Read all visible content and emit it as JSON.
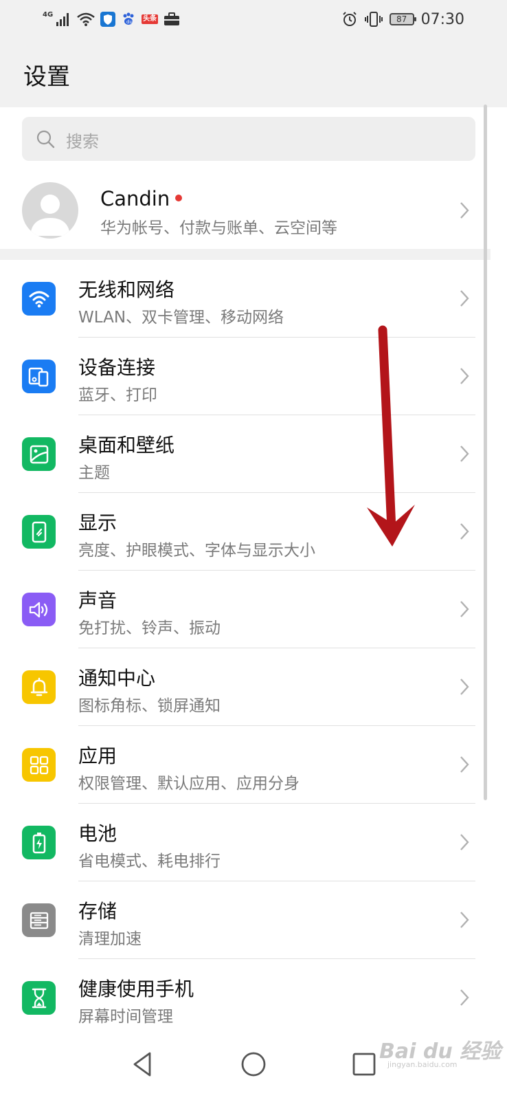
{
  "status_bar": {
    "network": "4G",
    "news_badge": "头条",
    "battery": "87",
    "time": "07:30"
  },
  "header": {
    "title": "设置"
  },
  "search": {
    "placeholder": "搜索"
  },
  "profile": {
    "name": "Candin",
    "subtitle": "华为帐号、付款与账单、云空间等"
  },
  "settings_items": [
    {
      "title": "无线和网络",
      "subtitle": "WLAN、双卡管理、移动网络",
      "icon": "wifi-icon",
      "color": "#1a7cf3"
    },
    {
      "title": "设备连接",
      "subtitle": "蓝牙、打印",
      "icon": "device-connection-icon",
      "color": "#1a7cf3"
    },
    {
      "title": "桌面和壁纸",
      "subtitle": "主题",
      "icon": "wallpaper-icon",
      "color": "#12b862"
    },
    {
      "title": "显示",
      "subtitle": "亮度、护眼模式、字体与显示大小",
      "icon": "display-icon",
      "color": "#12b862"
    },
    {
      "title": "声音",
      "subtitle": "免打扰、铃声、振动",
      "icon": "sound-icon",
      "color": "#8a5cf5"
    },
    {
      "title": "通知中心",
      "subtitle": "图标角标、锁屏通知",
      "icon": "notification-bell-icon",
      "color": "#f7c600"
    },
    {
      "title": "应用",
      "subtitle": "权限管理、默认应用、应用分身",
      "icon": "apps-grid-icon",
      "color": "#f7c600"
    },
    {
      "title": "电池",
      "subtitle": "省电模式、耗电排行",
      "icon": "battery-icon",
      "color": "#12b862"
    },
    {
      "title": "存储",
      "subtitle": "清理加速",
      "icon": "storage-icon",
      "color": "#8a8a8a"
    },
    {
      "title": "健康使用手机",
      "subtitle": "屏幕时间管理",
      "icon": "hourglass-icon",
      "color": "#12b862"
    }
  ],
  "watermark": {
    "text": "Bai du 经验",
    "sub": "jingyan.baidu.com"
  }
}
